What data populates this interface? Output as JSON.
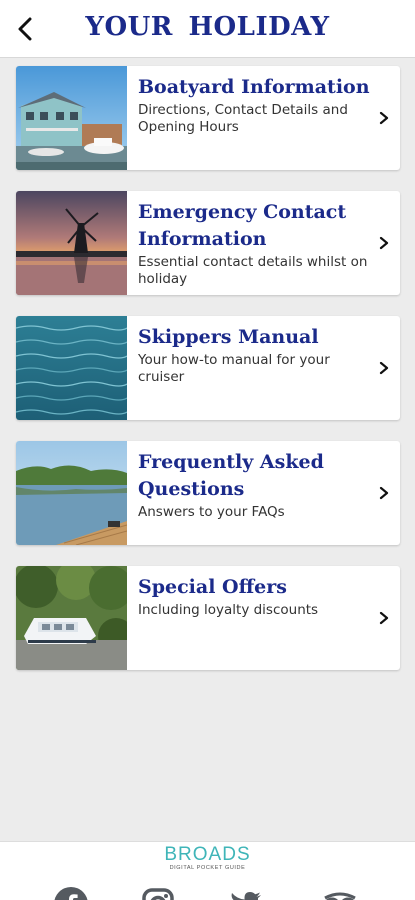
{
  "header": {
    "title": "YOUR  HOLIDAY"
  },
  "items": [
    {
      "title": "Boatyard Information",
      "subtitle": "Directions, Contact Details and Opening Hours"
    },
    {
      "title": "Emergency Contact Information",
      "subtitle": "Essential contact details whilst on holiday"
    },
    {
      "title": "Skippers Manual",
      "subtitle": "Your how-to manual for your cruiser"
    },
    {
      "title": "Frequently Asked Questions",
      "subtitle": "Answers to your  FAQs"
    },
    {
      "title": "Special Offers",
      "subtitle": "Including loyalty discounts"
    }
  ],
  "footer": {
    "brand": "BROADS",
    "tagline": "DIGITAL POCKET GUIDE"
  },
  "colors": {
    "title_blue": "#1b2a8a",
    "brand_teal": "#3fb5b8",
    "background": "#ececec"
  },
  "icons": [
    "back-arrow-icon",
    "chevron-right-icon",
    "facebook-icon",
    "instagram-icon",
    "twitter-icon",
    "tripadvisor-icon"
  ]
}
